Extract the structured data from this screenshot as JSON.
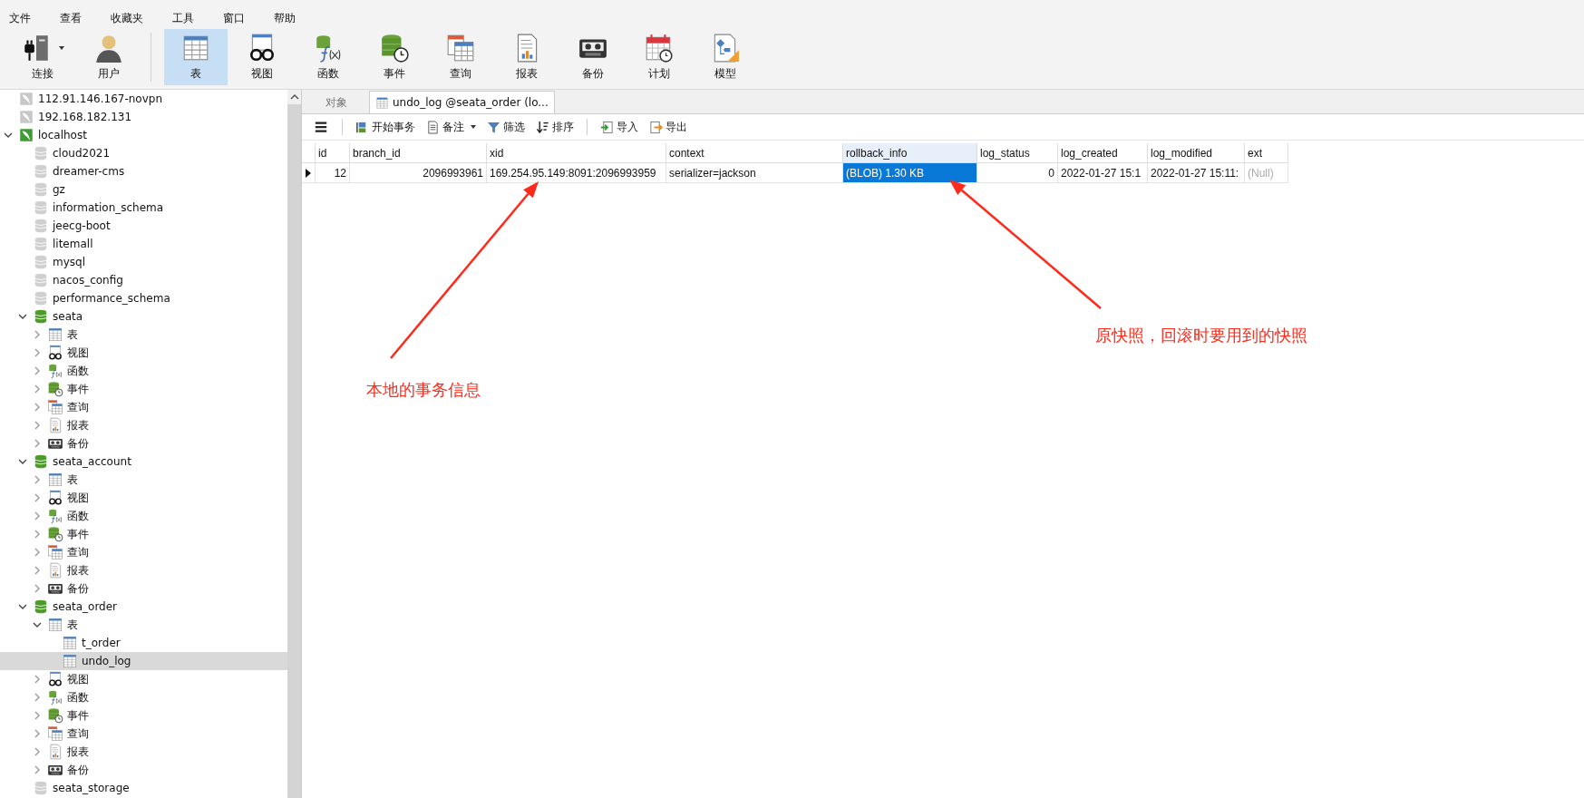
{
  "menu": [
    "文件",
    "查看",
    "收藏夹",
    "工具",
    "窗口",
    "帮助"
  ],
  "toolbar": [
    {
      "label": "连接",
      "kind": "connection",
      "dropdown": true,
      "selected": false
    },
    {
      "label": "用户",
      "kind": "user",
      "selected": false
    },
    {
      "label": "表",
      "kind": "table",
      "selected": true
    },
    {
      "label": "视图",
      "kind": "view",
      "selected": false
    },
    {
      "label": "函数",
      "kind": "function",
      "selected": false
    },
    {
      "label": "事件",
      "kind": "event",
      "selected": false
    },
    {
      "label": "查询",
      "kind": "query",
      "selected": false
    },
    {
      "label": "报表",
      "kind": "report",
      "selected": false
    },
    {
      "label": "备份",
      "kind": "backup",
      "selected": false
    },
    {
      "label": "计划",
      "kind": "schedule",
      "selected": false
    },
    {
      "label": "模型",
      "kind": "model",
      "selected": false
    }
  ],
  "sidebar": {
    "items": [
      {
        "label": "112.91.146.167-novpn",
        "kind": "server",
        "open": false,
        "selected": false
      },
      {
        "label": "192.168.182.131",
        "kind": "server",
        "open": false,
        "selected": false
      },
      {
        "label": "localhost",
        "kind": "server",
        "open": true,
        "expanded": true,
        "selected": false,
        "children": [
          {
            "label": "cloud2021",
            "kind": "database",
            "open": false,
            "selected": false
          },
          {
            "label": "dreamer-cms",
            "kind": "database",
            "open": false,
            "selected": false
          },
          {
            "label": "gz",
            "kind": "database",
            "open": false,
            "selected": false
          },
          {
            "label": "information_schema",
            "kind": "database",
            "open": false,
            "selected": false
          },
          {
            "label": "jeecg-boot",
            "kind": "database",
            "open": false,
            "selected": false
          },
          {
            "label": "litemall",
            "kind": "database",
            "open": false,
            "selected": false
          },
          {
            "label": "mysql",
            "kind": "database",
            "open": false,
            "selected": false
          },
          {
            "label": "nacos_config",
            "kind": "database",
            "open": false,
            "selected": false
          },
          {
            "label": "performance_schema",
            "kind": "database",
            "open": false,
            "selected": false
          },
          {
            "label": "seata",
            "kind": "database",
            "open": true,
            "expanded": true,
            "selected": false,
            "children": [
              {
                "label": "表",
                "kind": "table",
                "expanded": false,
                "selected": false
              },
              {
                "label": "视图",
                "kind": "view",
                "expanded": false,
                "selected": false
              },
              {
                "label": "函数",
                "kind": "function",
                "expanded": false,
                "selected": false
              },
              {
                "label": "事件",
                "kind": "event",
                "expanded": false,
                "selected": false
              },
              {
                "label": "查询",
                "kind": "query",
                "expanded": false,
                "selected": false
              },
              {
                "label": "报表",
                "kind": "report",
                "expanded": false,
                "selected": false
              },
              {
                "label": "备份",
                "kind": "backup",
                "expanded": false,
                "selected": false
              }
            ]
          },
          {
            "label": "seata_account",
            "kind": "database",
            "open": true,
            "expanded": true,
            "selected": false,
            "children": [
              {
                "label": "表",
                "kind": "table",
                "expanded": false,
                "selected": false
              },
              {
                "label": "视图",
                "kind": "view",
                "expanded": false,
                "selected": false
              },
              {
                "label": "函数",
                "kind": "function",
                "expanded": false,
                "selected": false
              },
              {
                "label": "事件",
                "kind": "event",
                "expanded": false,
                "selected": false
              },
              {
                "label": "查询",
                "kind": "query",
                "expanded": false,
                "selected": false
              },
              {
                "label": "报表",
                "kind": "report",
                "expanded": false,
                "selected": false
              },
              {
                "label": "备份",
                "kind": "backup",
                "expanded": false,
                "selected": false
              }
            ]
          },
          {
            "label": "seata_order",
            "kind": "database",
            "open": true,
            "expanded": true,
            "selected": false,
            "children": [
              {
                "label": "表",
                "kind": "table",
                "expanded": true,
                "selected": false,
                "children": [
                  {
                    "label": "t_order",
                    "kind": "table",
                    "selected": false
                  },
                  {
                    "label": "undo_log",
                    "kind": "table",
                    "selected": true
                  }
                ]
              },
              {
                "label": "视图",
                "kind": "view",
                "expanded": false,
                "selected": false
              },
              {
                "label": "函数",
                "kind": "function",
                "expanded": false,
                "selected": false
              },
              {
                "label": "事件",
                "kind": "event",
                "expanded": false,
                "selected": false
              },
              {
                "label": "查询",
                "kind": "query",
                "expanded": false,
                "selected": false
              },
              {
                "label": "报表",
                "kind": "report",
                "expanded": false,
                "selected": false
              },
              {
                "label": "备份",
                "kind": "backup",
                "expanded": false,
                "selected": false
              }
            ]
          },
          {
            "label": "seata_storage",
            "kind": "database",
            "open": false,
            "selected": false
          }
        ]
      }
    ]
  },
  "tabs": [
    {
      "label": "对象",
      "selected": false
    },
    {
      "label": "undo_log @seata_order (lo...",
      "kind": "table",
      "selected": true
    }
  ],
  "grid_toolbar": [
    {
      "kind": "menu"
    },
    {
      "label": "开始事务",
      "kind": "transaction"
    },
    {
      "label": "备注",
      "kind": "note",
      "dropdown": true
    },
    {
      "label": "筛选",
      "kind": "filter"
    },
    {
      "label": "排序",
      "kind": "sort"
    },
    {
      "label": "导入",
      "kind": "import"
    },
    {
      "label": "导出",
      "kind": "export"
    }
  ],
  "table": {
    "columns": [
      {
        "label": "id",
        "kind": "number",
        "selected": false
      },
      {
        "label": "branch_id",
        "kind": "number",
        "selected": false
      },
      {
        "label": "xid",
        "kind": "text",
        "selected": false
      },
      {
        "label": "context",
        "kind": "text",
        "selected": false
      },
      {
        "label": "rollback_info",
        "kind": "text",
        "selected": true
      },
      {
        "label": "log_status",
        "kind": "number",
        "selected": false
      },
      {
        "label": "log_created",
        "kind": "text",
        "selected": false
      },
      {
        "label": "log_modified",
        "kind": "text",
        "selected": false
      },
      {
        "label": "ext",
        "kind": "text",
        "selected": false
      }
    ],
    "rows": [
      {
        "current": true,
        "cells": [
          {
            "text": "12",
            "selected": false
          },
          {
            "text": "2096993961",
            "selected": false
          },
          {
            "text": "169.254.95.149:8091:2096993959",
            "selected": false
          },
          {
            "text": "serializer=jackson",
            "selected": false
          },
          {
            "text": "(BLOB) 1.30 KB",
            "selected": true
          },
          {
            "text": "0",
            "selected": false
          },
          {
            "text": "2022-01-27 15:1",
            "selected": false
          },
          {
            "text": "2022-01-27 15:11:",
            "selected": false
          },
          {
            "text": "(Null)",
            "null": true,
            "selected": false
          }
        ]
      }
    ]
  },
  "annotations": [
    {
      "text": "本地的事务信息"
    },
    {
      "text": "原快照，回滚时要用到的快照"
    }
  ]
}
